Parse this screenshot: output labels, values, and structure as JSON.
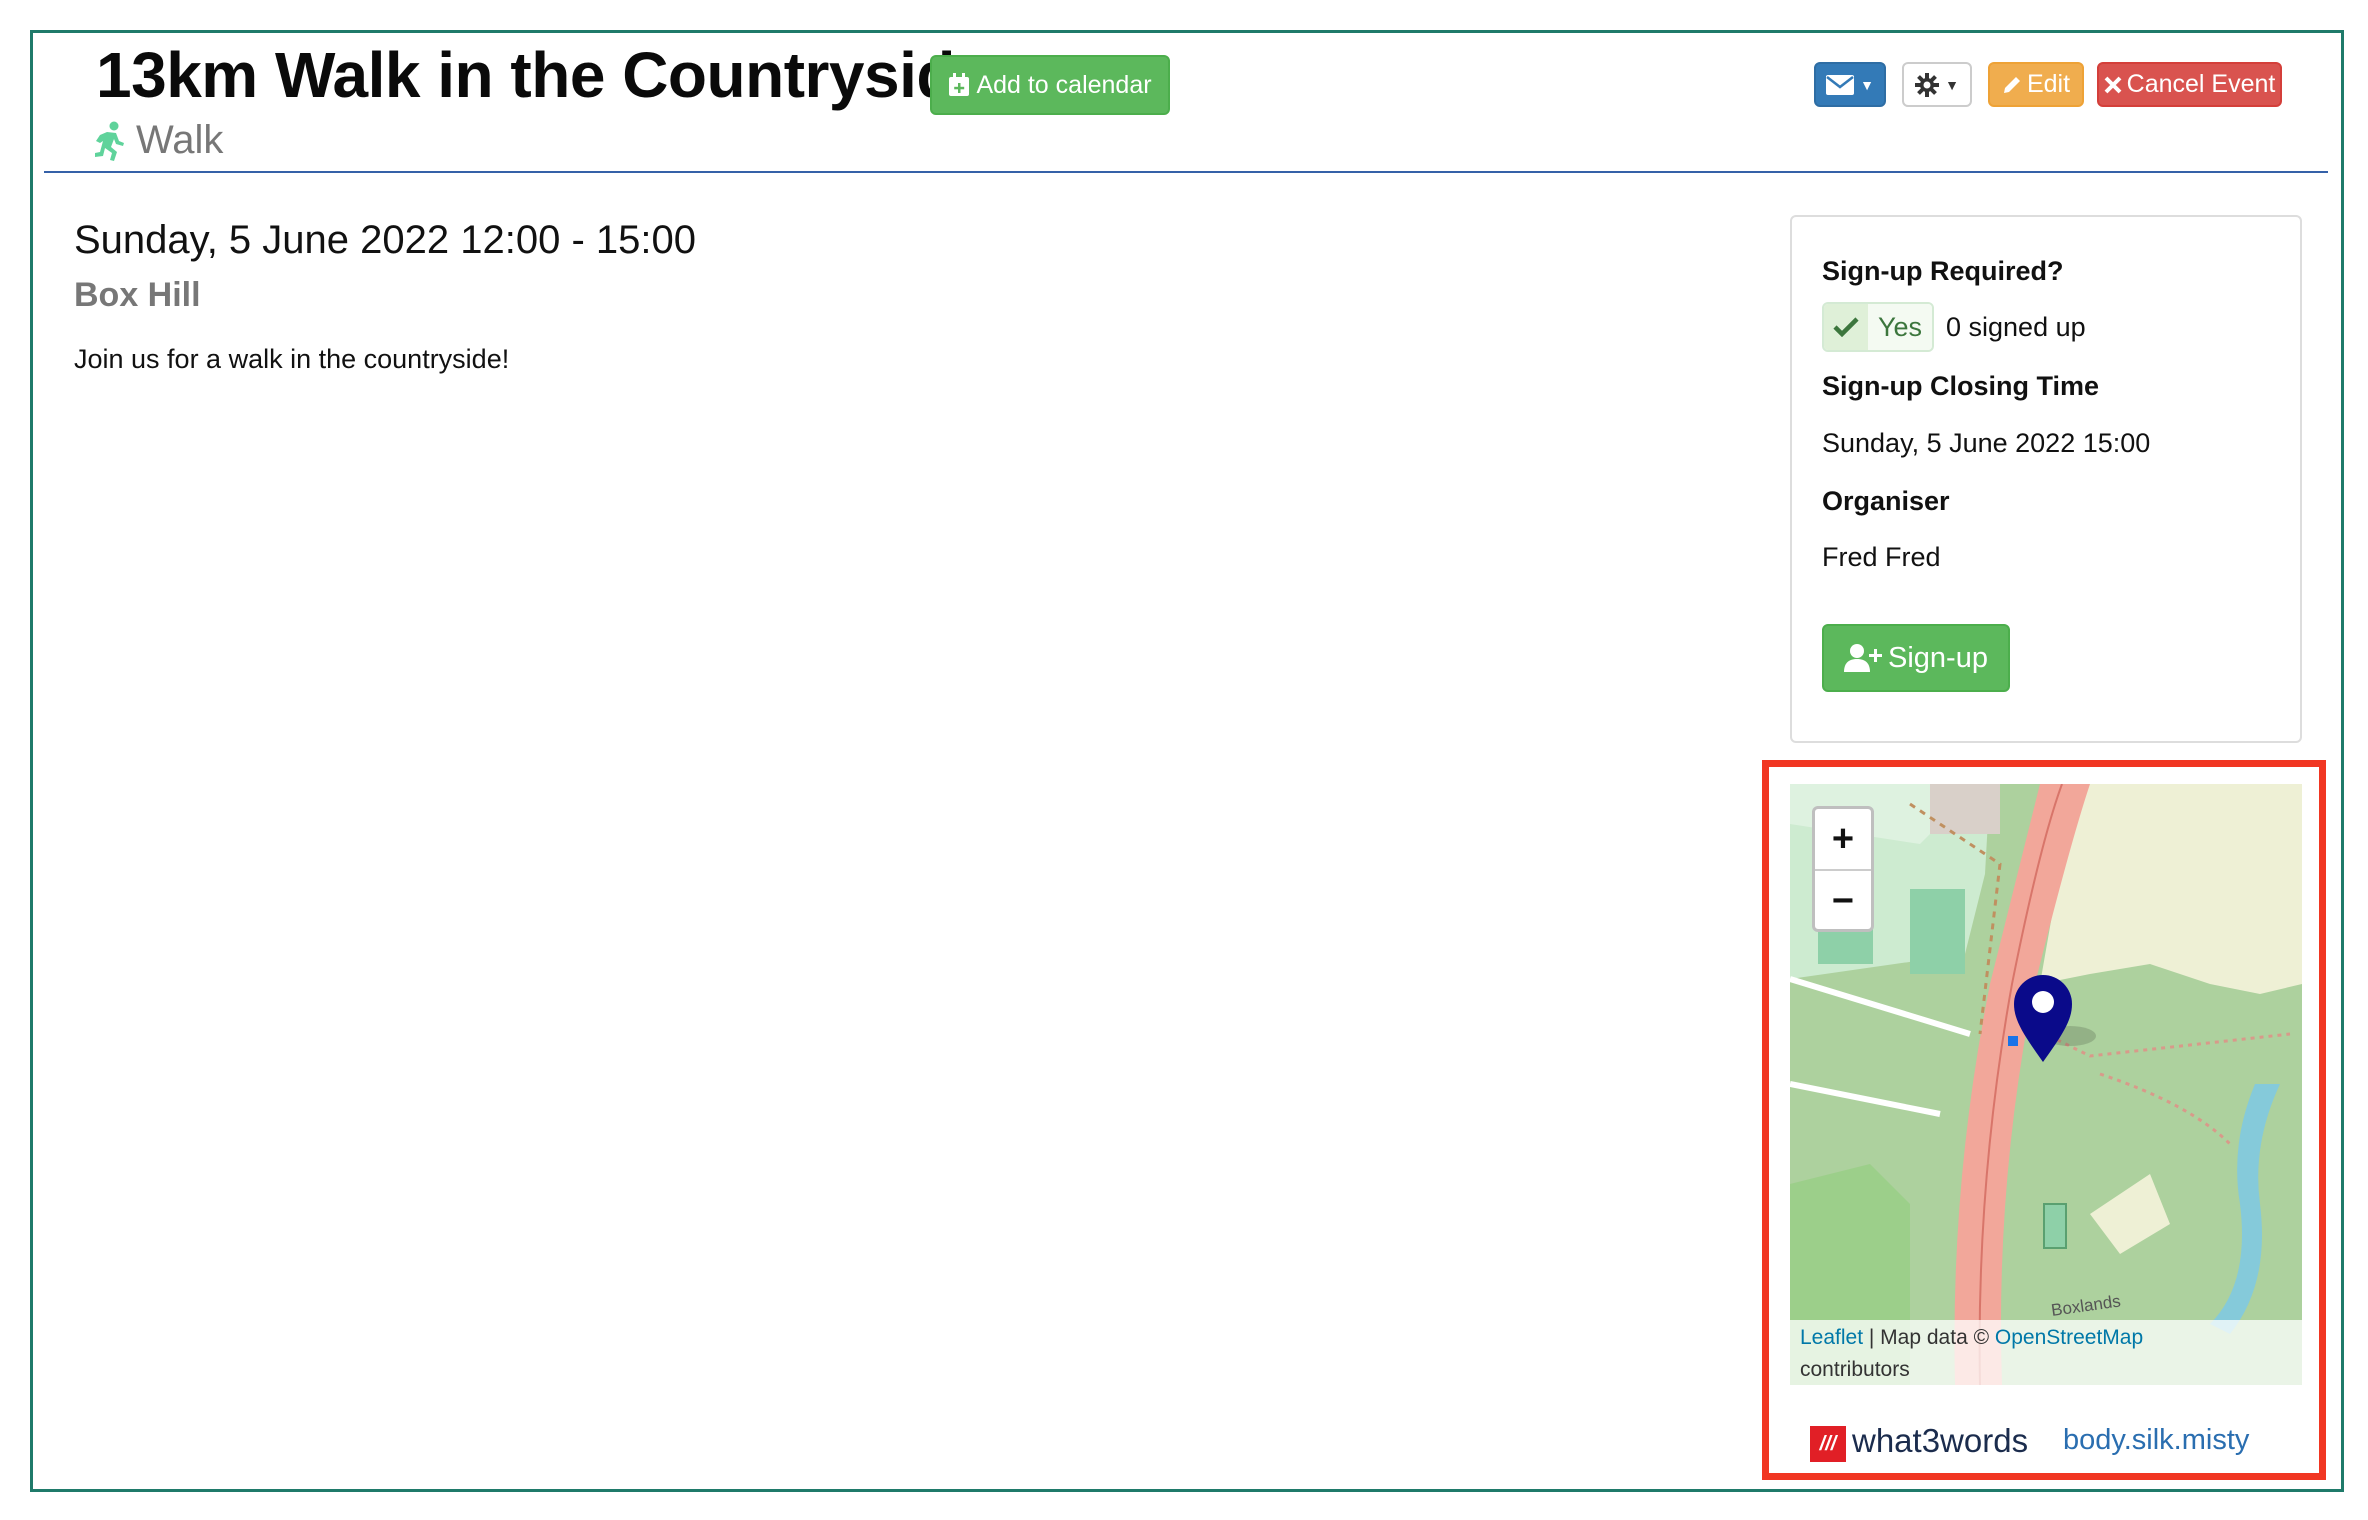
{
  "event": {
    "title": "13km Walk in the Countryside",
    "category": "Walk",
    "datetime": "Sunday, 5 June 2022 12:00 - 15:00",
    "location": "Box Hill",
    "description": "Join us for a walk in the countryside!"
  },
  "header_actions": {
    "add_to_calendar": "Add to calendar",
    "edit": "Edit",
    "cancel_event": "Cancel Event",
    "email_icon": "envelope-icon",
    "settings_icon": "gear-icon"
  },
  "signup_panel": {
    "required_label": "Sign-up Required?",
    "required_value": "Yes",
    "signed_up_count": "0 signed up",
    "closing_label": "Sign-up Closing Time",
    "closing_value": "Sunday, 5 June 2022 15:00",
    "organiser_label": "Organiser",
    "organiser_value": "Fred Fred",
    "signup_button": "Sign-up"
  },
  "map": {
    "zoom_in": "+",
    "zoom_out": "−",
    "attribution_leaflet": "Leaflet",
    "attribution_sep": " | Map data © ",
    "attribution_osm": "OpenStreetMap",
    "attribution_tail": "contributors",
    "place_label": "Boxlands"
  },
  "what3words": {
    "brand": "what3words",
    "address": "body.silk.misty"
  },
  "colors": {
    "accent_green": "#5cb85c",
    "primary_blue": "#337ab7",
    "warning_orange": "#f0ad4e",
    "danger_red": "#d9534f",
    "highlight_red": "#f13622",
    "marker_blue": "#0a0a8a"
  }
}
